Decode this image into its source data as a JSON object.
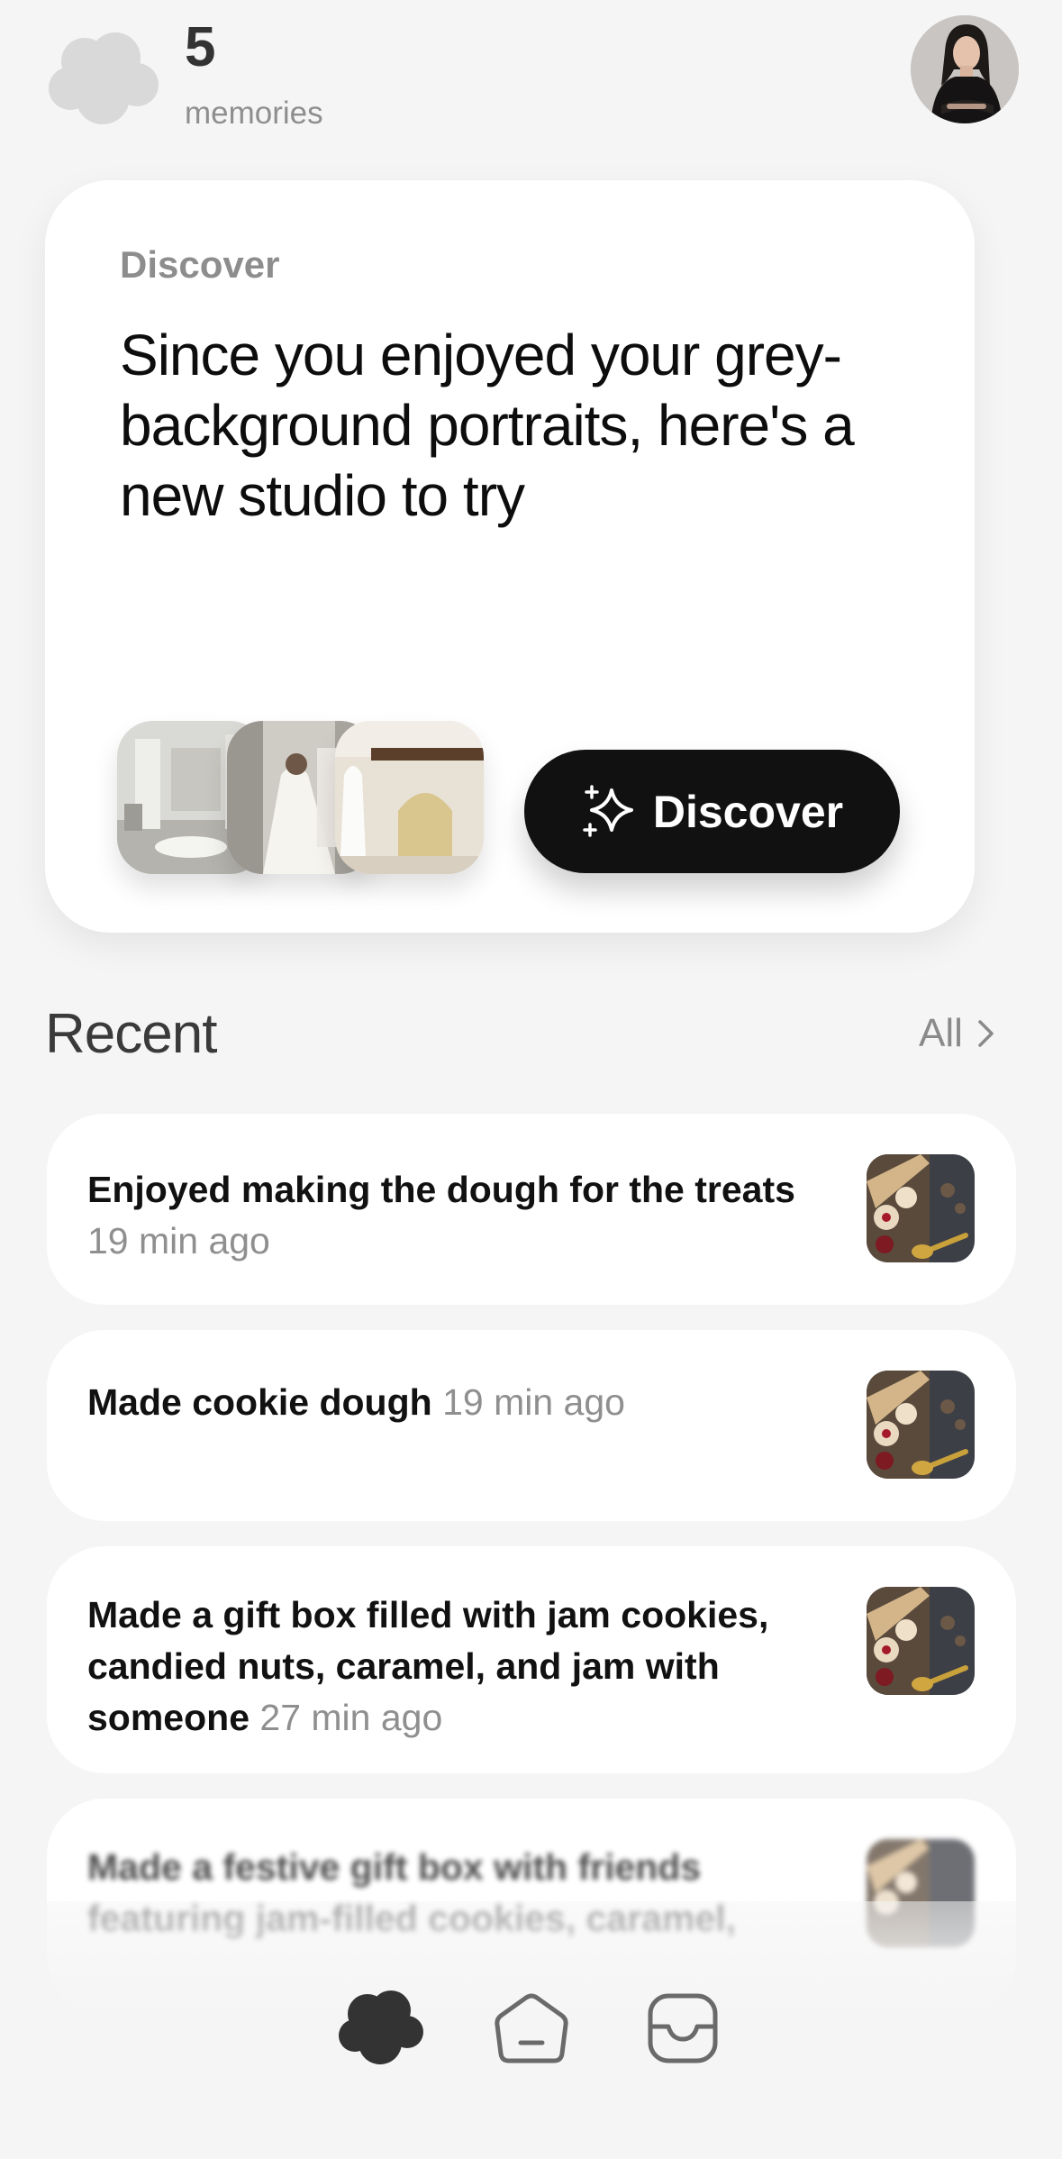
{
  "header": {
    "memory_count": "5",
    "memory_label": "memories",
    "logo_icon": "cloud-icon",
    "avatar_icon": "user-avatar"
  },
  "discover": {
    "eyebrow": "Discover",
    "headline": "Since you enjoyed your grey-background portraits, here's a new studio to try",
    "button_label": "Discover",
    "button_icon": "sparkle-icon"
  },
  "recent": {
    "title": "Recent",
    "all_label": "All",
    "all_icon": "chevron-right-icon",
    "items": [
      {
        "text": "Enjoyed making the dough for the treats",
        "time": "19 min ago"
      },
      {
        "text": "Made cookie dough",
        "time": "19 min ago"
      },
      {
        "text": "Made a gift box filled with jam cookies, candied nuts, caramel, and jam with someone",
        "time": "27 min ago"
      },
      {
        "text": "Made a festive gift box with friends featuring jam-filled cookies, caramel,",
        "time": ""
      }
    ]
  },
  "nav": {
    "items": [
      {
        "name": "memories",
        "icon": "cloud-icon",
        "active": true
      },
      {
        "name": "home",
        "icon": "home-icon",
        "active": false
      },
      {
        "name": "inbox",
        "icon": "inbox-icon",
        "active": false
      }
    ]
  },
  "colors": {
    "background": "#f5f5f5",
    "card": "#ffffff",
    "primary_button": "#111111",
    "muted_text": "#8f8f8f",
    "nav_active": "#333333",
    "nav_inactive": "#6a6a6a"
  }
}
